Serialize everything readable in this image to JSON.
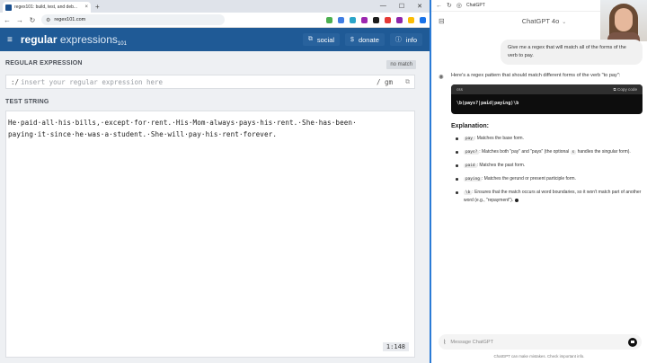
{
  "browser_left": {
    "tab_title": "regex101: build, test, and deb...",
    "url": "regex101.com",
    "window_controls": [
      "—",
      "☐",
      "✕"
    ],
    "ext_colors": [
      "#4caf50",
      "#3f7de3",
      "#2aa5c9",
      "#9c27b0",
      "#1b1b1b",
      "#e53935",
      "#8e24aa",
      "#fbbc04",
      "#1a73e8"
    ]
  },
  "r101": {
    "logo_bold": "regular",
    "logo_thin": "expressions",
    "logo_sub": "101",
    "nav": [
      {
        "icon": "social-icon",
        "glyph": "⧉",
        "label": "social"
      },
      {
        "icon": "dollar-icon",
        "glyph": "$",
        "label": "donate"
      },
      {
        "icon": "info-icon",
        "glyph": "ⓘ",
        "label": "info"
      }
    ],
    "regex_label": "REGULAR EXPRESSION",
    "no_match": "no match",
    "regex_delim": ":/",
    "regex_placeholder": "insert your regular expression here",
    "regex_flags": "/ gm",
    "test_label": "TEST STRING",
    "test_string": "He·paid·all·his·bills,·except·for·rent.·His·Mom·always·pays·his·rent.·She·has·been·\npaying·it·since·he·was·a·student.·She·will·pay·his·rent·forever.",
    "counter": "1:148"
  },
  "chatgpt": {
    "page_title": "ChatGPT",
    "model": "ChatGPT 4o",
    "user_message": "Give me a regex that will match all of the forms of the verb to pay.",
    "intro": "Here's a regex pattern that should match different forms of the verb \"to pay\":",
    "code_lang": "css",
    "copy_label": "Copy code",
    "regex": "\\b(pays?|paid|paying)\\b",
    "explanation_title": "Explanation:",
    "bullets": [
      {
        "code": "pay",
        "text": ": Matches the base form."
      },
      {
        "code": "pays?",
        "text": ": Matches both \"pay\" and \"pays\" (the optional",
        "code2": "s",
        "text2": "handles the singular form)."
      },
      {
        "code": "paid",
        "text": ": Matches the past form."
      },
      {
        "code": "paying",
        "text": ": Matches the gerund or present participle form."
      },
      {
        "code": "\\b",
        "text": ": Ensures that the match occurs at word boundaries, so it won't match part of another word (e.g., \"repayment\")."
      }
    ],
    "composer_placeholder": "Message ChatGPT",
    "disclaimer": "ChatGPT can make mistakes. Check important info."
  }
}
